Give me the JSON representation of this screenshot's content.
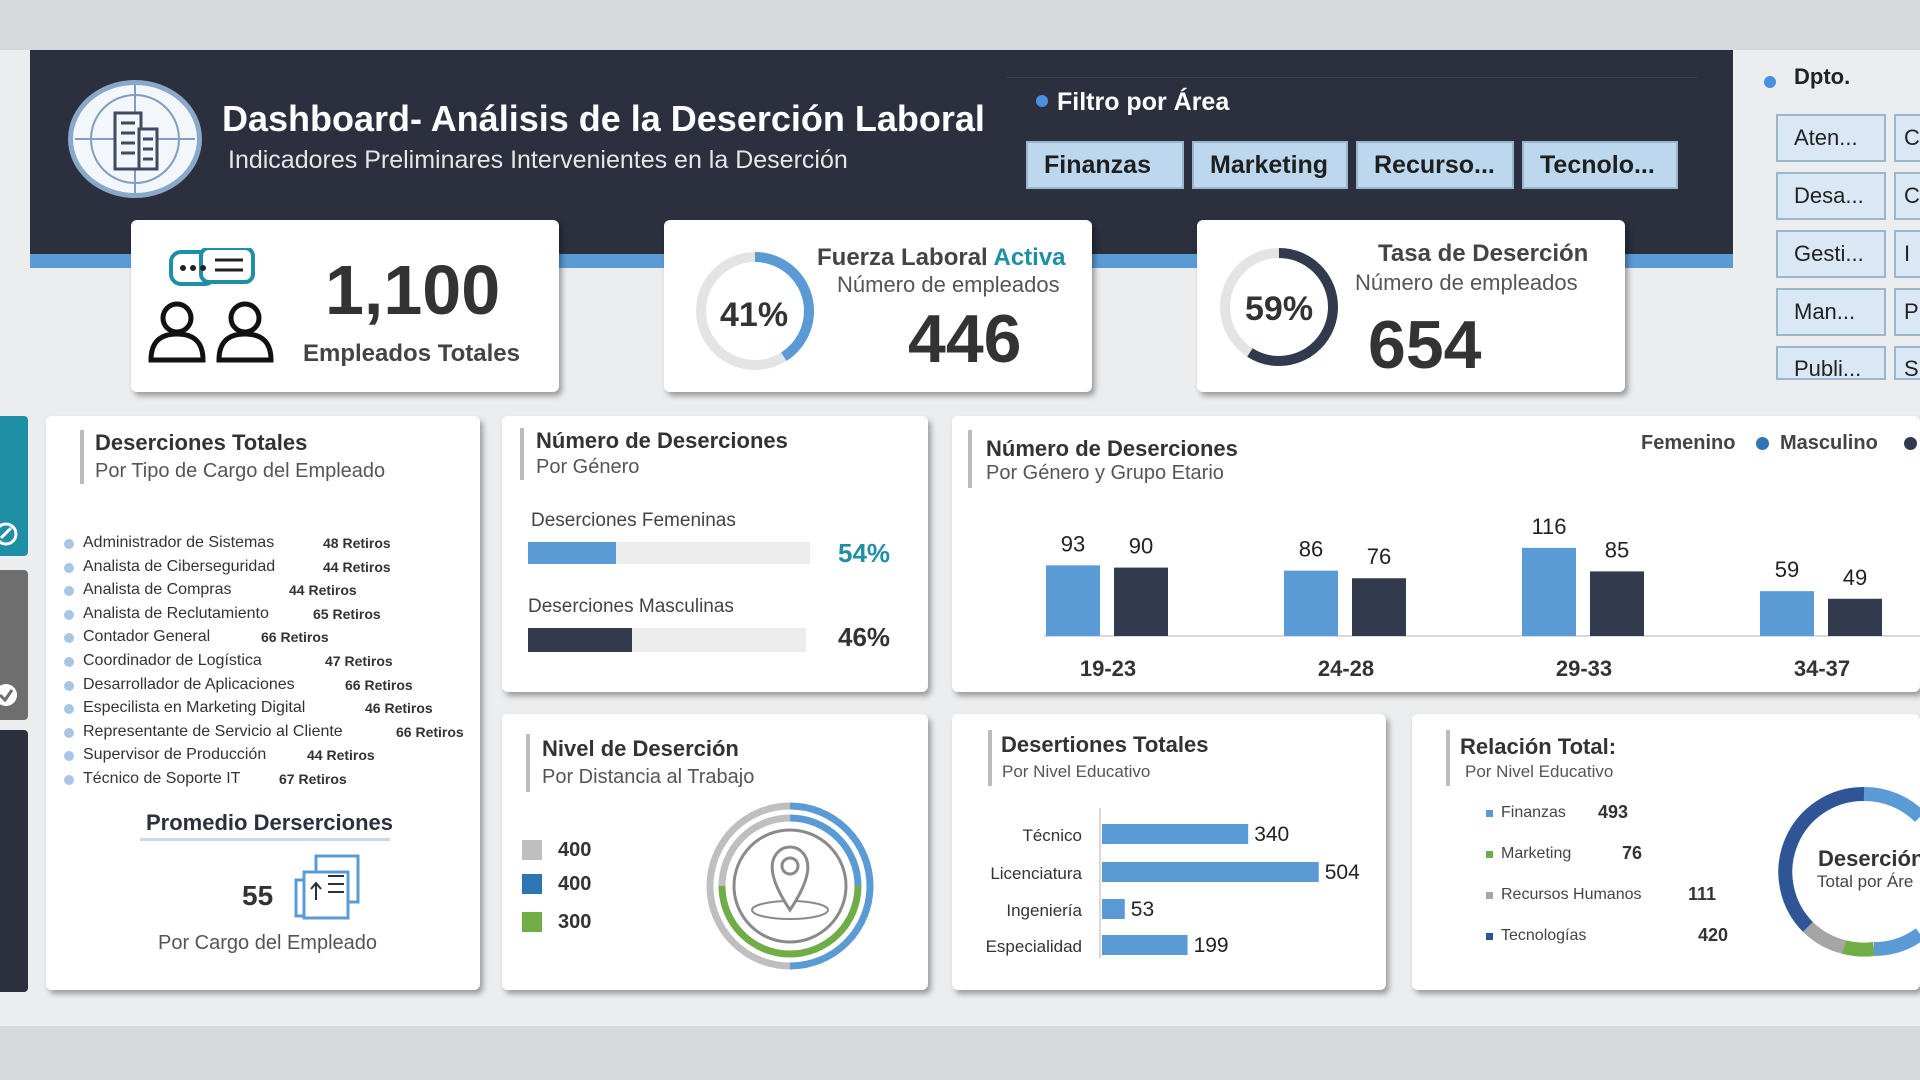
{
  "header": {
    "title": "Dashboard- Análisis de la Deserción Laboral",
    "subtitle": "Indicadores Preliminares Intervenientes en la Deserción",
    "filter_title": "Filtro por Área",
    "filter_buttons": [
      "Finanzas",
      "Marketing",
      "Recurso...",
      "Tecnolo..."
    ]
  },
  "slicer": {
    "title": "Dpto.",
    "col1": [
      "Aten...",
      "Desa...",
      "Gesti...",
      "Man...",
      "Publi..."
    ],
    "col2": [
      "C",
      "C",
      "I",
      "P",
      "S"
    ]
  },
  "kpi_total": {
    "value": "1,100",
    "label": "Empleados Totales"
  },
  "kpi_active": {
    "title_a": "Fuerza Laboral ",
    "title_b": "Activa",
    "sub": "Número de empleados",
    "value": "446",
    "pct_label": "41%",
    "pct": 0.41
  },
  "kpi_desertion": {
    "title": "Tasa de Deserción",
    "sub": "Número de empleados",
    "value": "654",
    "pct_label": "59%",
    "pct": 0.59
  },
  "by_job": {
    "title": "Deserciones Totales",
    "subtitle": "Por Tipo de Cargo del Empleado",
    "items": [
      {
        "label": "Administrador de Sistemas",
        "value": "48 Retiros"
      },
      {
        "label": "Analista de Ciberseguridad",
        "value": "44 Retiros"
      },
      {
        "label": "Analista de Compras",
        "value": "44 Retiros"
      },
      {
        "label": "Analista de Reclutamiento",
        "value": "65 Retiros"
      },
      {
        "label": "Contador General",
        "value": "66 Retiros"
      },
      {
        "label": "Coordinador de Logística",
        "value": "47 Retiros"
      },
      {
        "label": "Desarrollador de Aplicaciones",
        "value": "66 Retiros"
      },
      {
        "label": "Especilista en Marketing Digital",
        "value": "46 Retiros"
      },
      {
        "label": "Representante de Servicio al Cliente",
        "value": "66 Retiros"
      },
      {
        "label": "Supervisor de Producción",
        "value": "44 Retiros"
      },
      {
        "label": "Técnico de Soporte IT",
        "value": "67 Retiros"
      }
    ],
    "avg_title": "Promedio Derserciones",
    "avg_value": "55",
    "avg_label": "Por Cargo del Empleado"
  },
  "by_gender": {
    "title": "Número de Deserciones",
    "subtitle": "Por Género",
    "fem_label": "Deserciones Femeninas",
    "fem_pct_label": "54%",
    "fem_pct": 0.54,
    "masc_label": "Deserciones Masculinas",
    "masc_pct_label": "46%",
    "masc_pct": 0.46
  },
  "distance": {
    "title": "Nivel de Deserción",
    "subtitle": "Por Distancia al Trabajo",
    "legend": [
      {
        "value": "400",
        "color": "#bfbfbf"
      },
      {
        "value": "400",
        "color": "#2e75b6"
      },
      {
        "value": "300",
        "color": "#70ad47"
      }
    ]
  },
  "by_education": {
    "title": "Desertiones Totales",
    "subtitle": "Por Nivel Educativo"
  },
  "relation": {
    "title": "Relación Total:",
    "subtitle": "Por Nivel Educativo",
    "items": [
      {
        "label": "Finanzas",
        "value": "493",
        "color": "#5b9bd5"
      },
      {
        "label": "Marketing",
        "value": "76",
        "color": "#70ad47"
      },
      {
        "label": "Recursos Humanos",
        "value": "111",
        "color": "#a5a5a5"
      },
      {
        "label": "Tecnologías",
        "value": "420",
        "color": "#2f5597"
      }
    ],
    "donut_title": "Deserción",
    "donut_sub": "Total por Áre"
  },
  "chart_data": [
    {
      "type": "bar",
      "title": "Número de Deserciones",
      "subtitle": "Por Género y Grupo Etario",
      "categories": [
        "19-23",
        "24-28",
        "29-33",
        "34-37"
      ],
      "series": [
        {
          "name": "Femenino",
          "values": [
            93,
            86,
            116,
            59
          ],
          "color": "#5b9bd5"
        },
        {
          "name": "Masculino",
          "values": [
            90,
            76,
            85,
            49
          ],
          "color": "#323a4e"
        }
      ],
      "legend": "top-right"
    },
    {
      "type": "bar",
      "orientation": "horizontal",
      "title": "Desertiones Totales",
      "subtitle": "Por Nivel Educativo",
      "categories": [
        "Técnico",
        "Licenciatura",
        "Ingeniería",
        "Especialidad"
      ],
      "values": [
        340,
        504,
        53,
        199
      ],
      "color": "#5b9bd5"
    }
  ]
}
